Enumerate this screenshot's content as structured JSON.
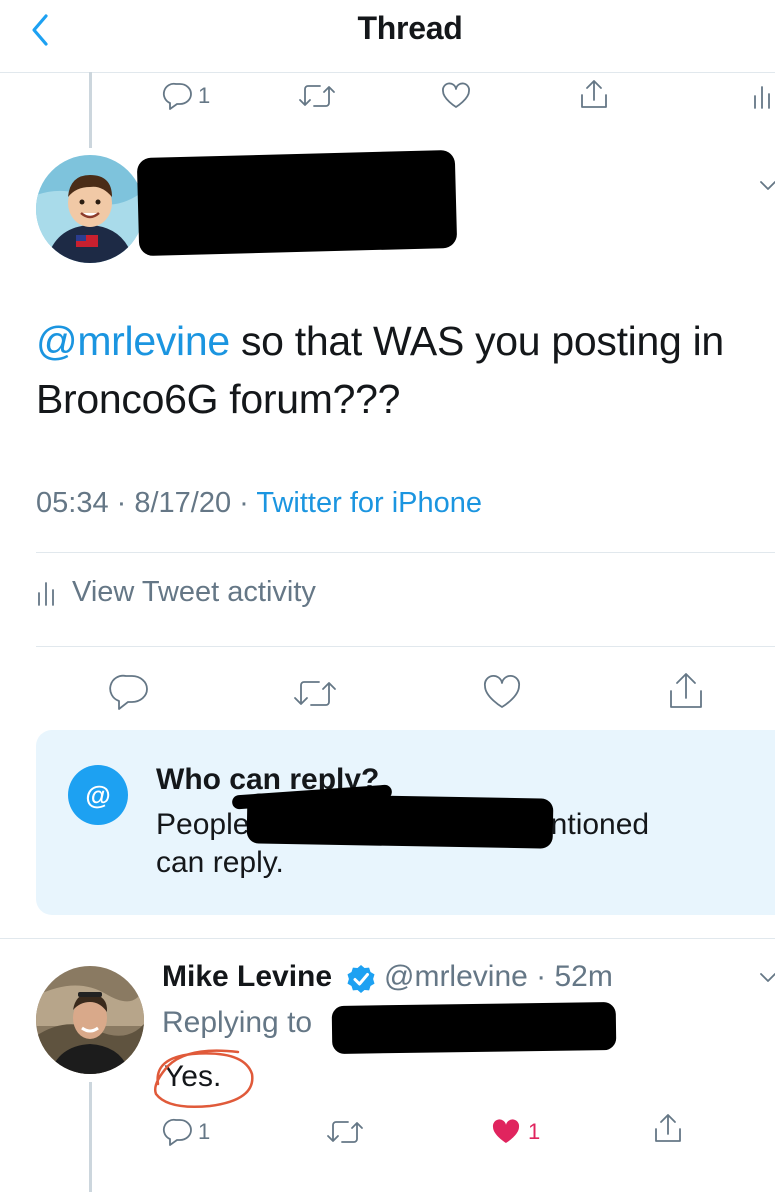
{
  "header": {
    "title": "Thread"
  },
  "prev_tweet": {
    "reply_count": "1"
  },
  "tweet": {
    "mention": "@mrlevine",
    "text": " so that WAS you posting in Bronco6G forum???",
    "time": "05:34 · 8/17/20 · ",
    "source": "Twitter for iPhone",
    "activity_label": "View Tweet activity"
  },
  "who_can_reply": {
    "badge": "@",
    "title": "Who can reply?",
    "line1_start": "People",
    "line1_end": "entioned",
    "line2": "can reply."
  },
  "reply": {
    "name": "Mike Levine",
    "handle": "@mrlevine · 52m",
    "replying_to": "Replying to",
    "text": "Yes.",
    "reply_count": "1",
    "like_count": "1"
  },
  "colors": {
    "accent": "#1da1f2",
    "link": "#1b95e0",
    "like": "#e0245e",
    "annotation": "#e05a3a"
  }
}
